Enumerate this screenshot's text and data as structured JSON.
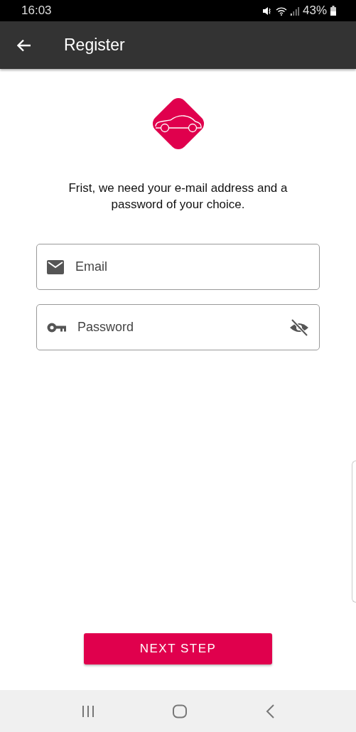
{
  "status_bar": {
    "time": "16:03",
    "battery": "43%"
  },
  "app_bar": {
    "title": "Register"
  },
  "intro": "Frist, we need your e-mail address and a password of your choice.",
  "fields": [
    {
      "kind": "email",
      "placeholder": "Email"
    },
    {
      "kind": "password",
      "placeholder": "Password",
      "password_visible": false
    }
  ],
  "button": "NEXT STEP"
}
